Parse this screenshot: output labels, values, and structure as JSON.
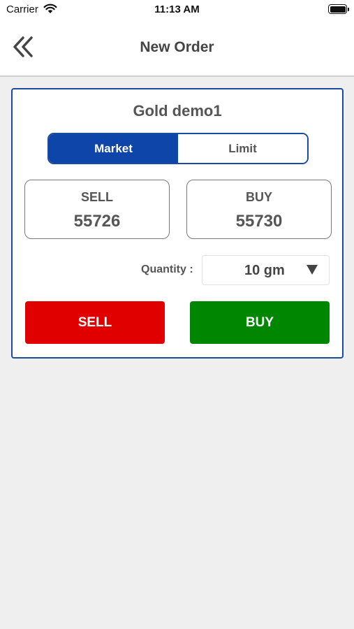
{
  "status_bar": {
    "carrier": "Carrier",
    "time": "11:13 AM"
  },
  "header": {
    "back_icon": "double-chevron-left-icon",
    "title": "New Order"
  },
  "order": {
    "product": "Gold demo1",
    "order_types": [
      {
        "label": "Market",
        "selected": true
      },
      {
        "label": "Limit",
        "selected": false
      }
    ],
    "sell_quote": {
      "label": "SELL",
      "price": "55726"
    },
    "buy_quote": {
      "label": "BUY",
      "price": "55730"
    },
    "quantity_label": "Quantity :",
    "quantity_value": "10 gm",
    "sell_button": "SELL",
    "buy_button": "BUY"
  },
  "colors": {
    "accent": "#0e45a8",
    "sell": "#e10000",
    "buy": "#008600"
  }
}
